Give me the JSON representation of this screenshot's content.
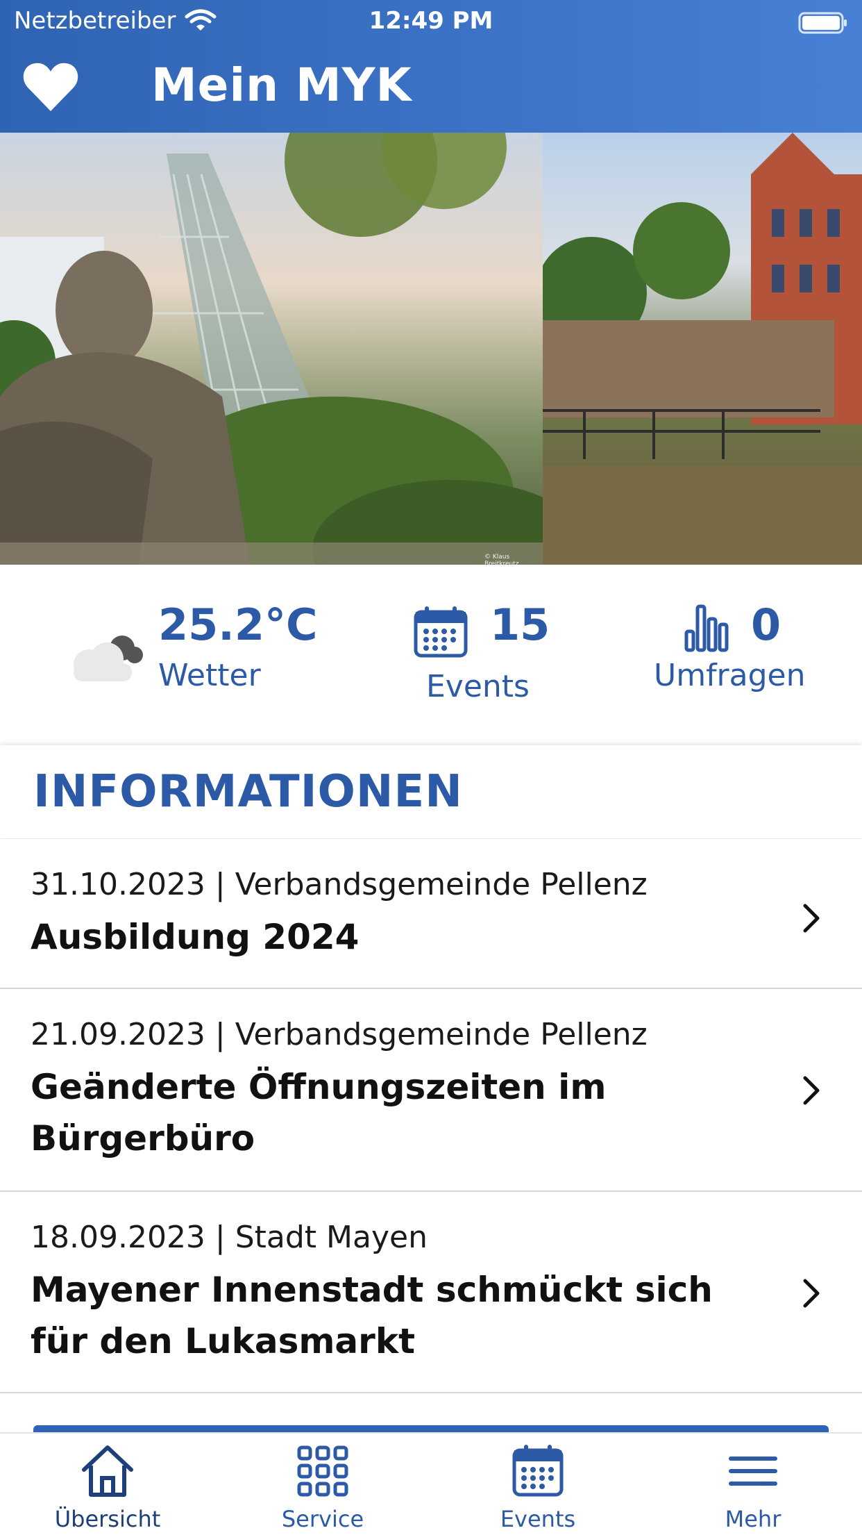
{
  "status_bar": {
    "carrier": "Netzbetreiber",
    "time": "12:49 PM"
  },
  "header": {
    "title": "Mein MYK",
    "icon": "heart-icon",
    "gradient_start": "#2f63b3",
    "gradient_end": "#4880d6"
  },
  "hero": {
    "photo_credit": "© Klaus Breitkreutz"
  },
  "stats": {
    "weather": {
      "value": "25.2°C",
      "label": "Wetter",
      "icon": "cloud-icon"
    },
    "events": {
      "value": "15",
      "label": "Events",
      "icon": "calendar-icon"
    },
    "surveys": {
      "value": "0",
      "label": "Umfragen",
      "icon": "bar-chart-icon"
    }
  },
  "section": {
    "title": "INFORMATIONEN"
  },
  "news": [
    {
      "meta": "31.10.2023 | Verbandsgemeinde Pellenz",
      "title": "Ausbildung 2024"
    },
    {
      "meta": "21.09.2023 | Verbandsgemeinde Pellenz",
      "title": "Geänderte Öffnungszeiten im Bürgerbüro"
    },
    {
      "meta": "18.09.2023 | Stadt Mayen",
      "title": "Mayener Innenstadt schmückt sich für den Lukasmarkt"
    }
  ],
  "tabbar": {
    "tabs": [
      {
        "label": "Übersicht",
        "icon": "home-icon",
        "active": true
      },
      {
        "label": "Service",
        "icon": "grid-icon",
        "active": false
      },
      {
        "label": "Events",
        "icon": "calendar-icon",
        "active": false
      },
      {
        "label": "Mehr",
        "icon": "menu-icon",
        "active": false
      }
    ]
  },
  "colors": {
    "accent": "#2c5aa7",
    "active_tab": "#1e3f7a",
    "divider": "#d6d6d6"
  }
}
